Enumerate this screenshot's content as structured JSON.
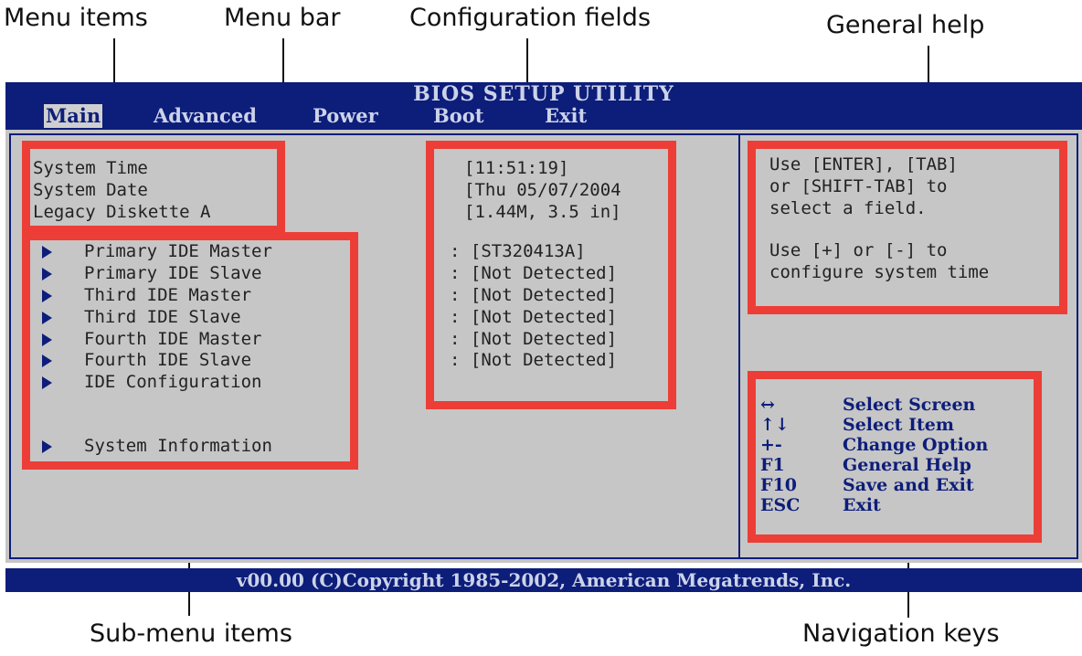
{
  "callouts": {
    "menu_items": "Menu items",
    "menu_bar": "Menu bar",
    "configuration_fields": "Configuration fields",
    "general_help": "General help",
    "sub_menu_items": "Sub-menu items",
    "navigation_keys": "Navigation keys"
  },
  "bios": {
    "title": "BIOS SETUP UTILITY",
    "menu": [
      "Main",
      "Advanced",
      "Power",
      "Boot",
      "Exit"
    ],
    "active_menu": "Main",
    "items": [
      "System Time",
      "System Date",
      "Legacy Diskette A"
    ],
    "item_values": [
      "[11:51:19]",
      "[Thu 05/07/2004",
      "[1.44M, 3.5 in]"
    ],
    "submenu": [
      "Primary IDE Master",
      "Primary IDE Slave",
      "Third IDE Master",
      "Third IDE Slave",
      "Fourth IDE Master",
      "Fourth IDE Slave",
      "IDE Configuration",
      "System Information"
    ],
    "submenu_values": [
      ": [ST320413A]",
      ": [Not Detected]",
      ": [Not Detected]",
      ": [Not Detected]",
      ": [Not Detected]",
      ": [Not Detected]"
    ],
    "help": [
      "Use [ENTER], [TAB]",
      "or [SHIFT-TAB] to",
      "select a field.",
      "",
      "Use [+] or [-] to",
      "configure system time"
    ],
    "nav_keys": [
      {
        "key": "↔",
        "action": "Select Screen"
      },
      {
        "key": "↑↓",
        "action": "Select Item"
      },
      {
        "key": "+-",
        "action": "Change Option"
      },
      {
        "key": "F1",
        "action": "General Help"
      },
      {
        "key": "F10",
        "action": "Save and Exit"
      },
      {
        "key": "ESC",
        "action": "Exit"
      }
    ],
    "footer": "v00.00 (C)Copyright 1985-2002, American Megatrends, Inc."
  },
  "colors": {
    "bios_blue": "#0d1d7a",
    "panel_gray": "#c6c6c6",
    "highlight_red": "#ec3e36"
  }
}
